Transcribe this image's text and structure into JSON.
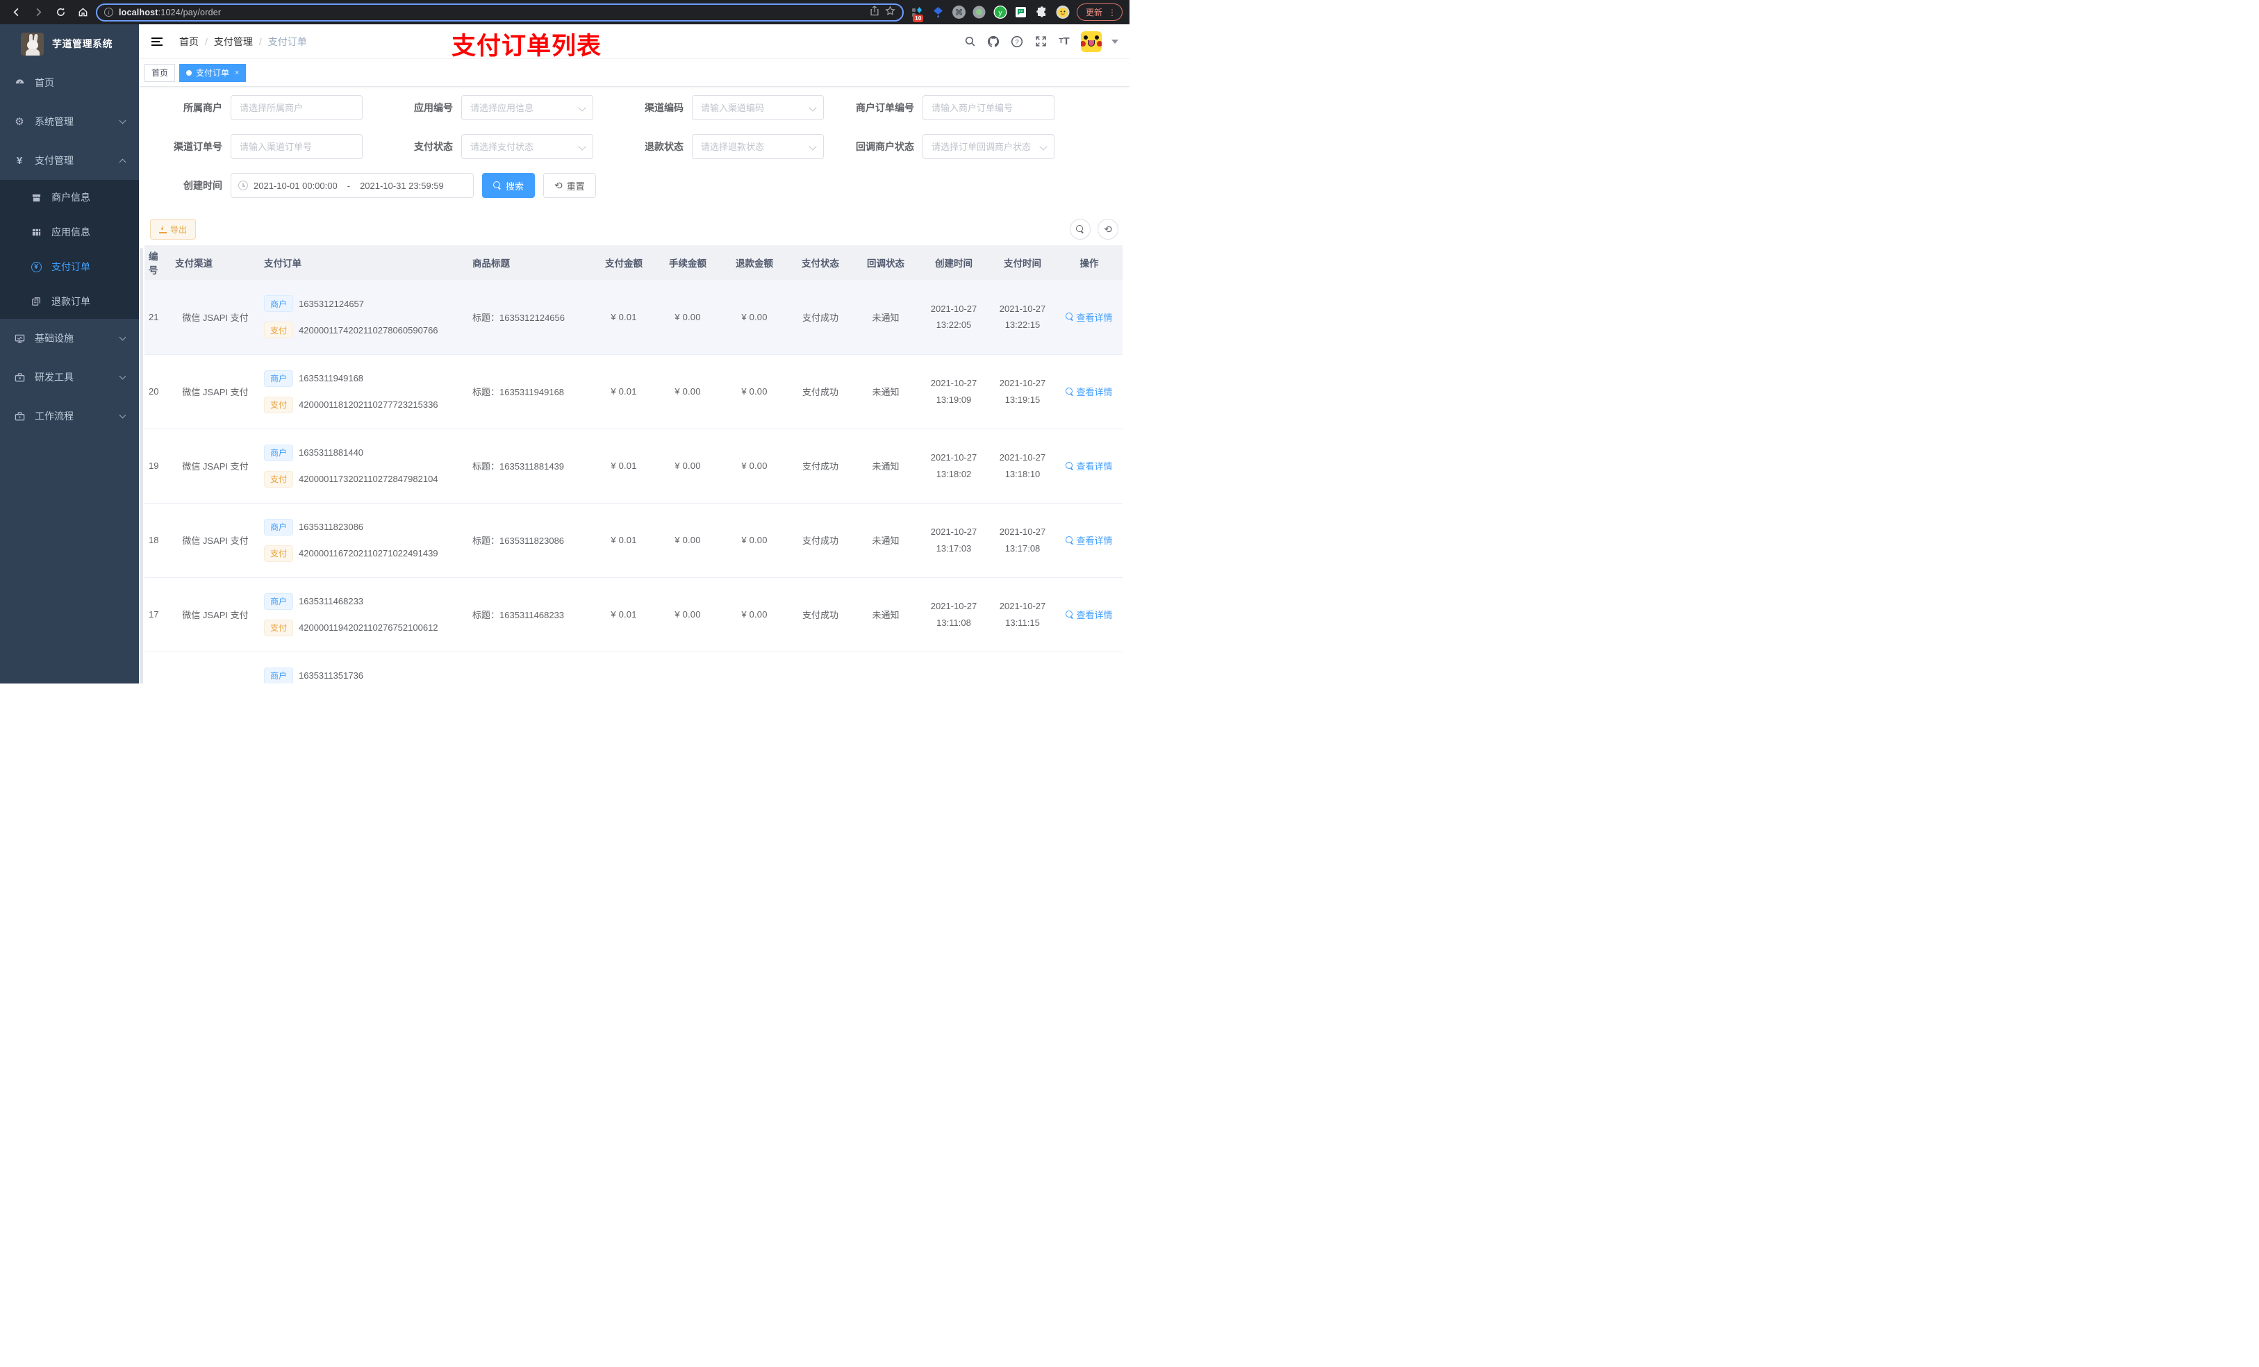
{
  "colors": {
    "accent": "#409eff",
    "annotation_red": "#fe0000",
    "warning": "#e6a23c",
    "sidebar_bg": "#304156"
  },
  "browser": {
    "url_host": "localhost",
    "url_rest": ":1024/pay/order",
    "extension_badge": "10",
    "update_label": "更新"
  },
  "sidebar": {
    "title": "芋道管理系统",
    "menu_top": [
      {
        "label": "首页"
      },
      {
        "label": "系统管理"
      },
      {
        "label": "支付管理"
      }
    ],
    "submenu": [
      {
        "label": "商户信息"
      },
      {
        "label": "应用信息"
      },
      {
        "label": "支付订单"
      },
      {
        "label": "退款订单"
      }
    ],
    "menu_bottom": [
      {
        "label": "基础设施"
      },
      {
        "label": "研发工具"
      },
      {
        "label": "工作流程"
      }
    ]
  },
  "header": {
    "breadcrumb": [
      "首页",
      "支付管理",
      "支付订单"
    ],
    "annotation": "支付订单列表"
  },
  "tags": {
    "home": "首页",
    "active": "支付订单",
    "close": "×"
  },
  "filters": {
    "merchant": {
      "label": "所属商户",
      "placeholder": "请选择所属商户"
    },
    "app": {
      "label": "应用编号",
      "placeholder": "请选择应用信息"
    },
    "channel_code": {
      "label": "渠道编码",
      "placeholder": "请输入渠道编码"
    },
    "merchant_order_no": {
      "label": "商户订单编号",
      "placeholder": "请输入商户订单编号"
    },
    "channel_order_no": {
      "label": "渠道订单号",
      "placeholder": "请输入渠道订单号"
    },
    "pay_status": {
      "label": "支付状态",
      "placeholder": "请选择支付状态"
    },
    "refund_status": {
      "label": "退款状态",
      "placeholder": "请选择退款状态"
    },
    "notify_status": {
      "label": "回调商户状态",
      "placeholder": "请选择订单回调商户状态"
    },
    "create_time": {
      "label": "创建时间",
      "start": "2021-10-01 00:00:00",
      "separator": "-",
      "end": "2021-10-31 23:59:59"
    },
    "search_label": "搜索",
    "reset_label": "重置"
  },
  "toolbar": {
    "export_label": "导出"
  },
  "table": {
    "headers": [
      "编号",
      "支付渠道",
      "支付订单",
      "商品标题",
      "支付金额",
      "手续金额",
      "退款金额",
      "支付状态",
      "回调状态",
      "创建时间",
      "支付时间",
      "操作"
    ],
    "merchant_tag": "商户",
    "pay_tag": "支付",
    "title_prefix": "标题：",
    "action_label": "查看详情",
    "rows": [
      {
        "id": "21",
        "channel": "微信 JSAPI 支付",
        "merchant_no": "1635312124657",
        "pay_no": "4200001174202110278060590766",
        "title": "1635312124656",
        "amount": "¥ 0.01",
        "fee": "¥ 0.00",
        "refund": "¥ 0.00",
        "status": "支付成功",
        "notify": "未通知",
        "create_date": "2021-10-27",
        "create_time": "13:22:05",
        "pay_date": "2021-10-27",
        "pay_time": "13:22:15",
        "highlight": true
      },
      {
        "id": "20",
        "channel": "微信 JSAPI 支付",
        "merchant_no": "1635311949168",
        "pay_no": "4200001181202110277723215336",
        "title": "1635311949168",
        "amount": "¥ 0.01",
        "fee": "¥ 0.00",
        "refund": "¥ 0.00",
        "status": "支付成功",
        "notify": "未通知",
        "create_date": "2021-10-27",
        "create_time": "13:19:09",
        "pay_date": "2021-10-27",
        "pay_time": "13:19:15"
      },
      {
        "id": "19",
        "channel": "微信 JSAPI 支付",
        "merchant_no": "1635311881440",
        "pay_no": "4200001173202110272847982104",
        "title": "1635311881439",
        "amount": "¥ 0.01",
        "fee": "¥ 0.00",
        "refund": "¥ 0.00",
        "status": "支付成功",
        "notify": "未通知",
        "create_date": "2021-10-27",
        "create_time": "13:18:02",
        "pay_date": "2021-10-27",
        "pay_time": "13:18:10"
      },
      {
        "id": "18",
        "channel": "微信 JSAPI 支付",
        "merchant_no": "1635311823086",
        "pay_no": "4200001167202110271022491439",
        "title": "1635311823086",
        "amount": "¥ 0.01",
        "fee": "¥ 0.00",
        "refund": "¥ 0.00",
        "status": "支付成功",
        "notify": "未通知",
        "create_date": "2021-10-27",
        "create_time": "13:17:03",
        "pay_date": "2021-10-27",
        "pay_time": "13:17:08"
      },
      {
        "id": "17",
        "channel": "微信 JSAPI 支付",
        "merchant_no": "1635311468233",
        "pay_no": "4200001194202110276752100612",
        "title": "1635311468233",
        "amount": "¥ 0.01",
        "fee": "¥ 0.00",
        "refund": "¥ 0.00",
        "status": "支付成功",
        "notify": "未通知",
        "create_date": "2021-10-27",
        "create_time": "13:11:08",
        "pay_date": "2021-10-27",
        "pay_time": "13:11:15"
      },
      {
        "id": "",
        "channel": "",
        "merchant_no": "1635311351736",
        "pay_no": "",
        "title": "",
        "amount": "",
        "fee": "",
        "refund": "",
        "status": "",
        "notify": "",
        "create_date": "",
        "create_time": "",
        "pay_date": "",
        "pay_time": "",
        "partial": true
      }
    ]
  }
}
